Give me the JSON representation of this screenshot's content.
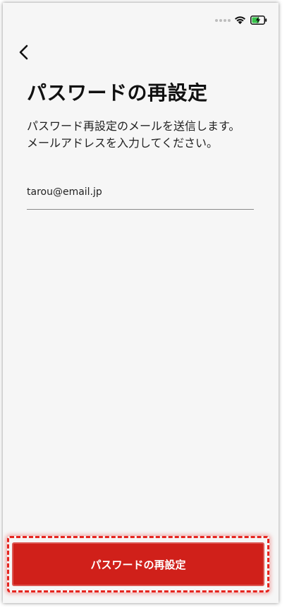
{
  "status_bar": {
    "signal_icon": "signal-dots-icon",
    "wifi_icon": "wifi-icon",
    "battery_icon": "battery-charging-icon",
    "battery_color": "#37c44a"
  },
  "nav": {
    "back_icon": "chevron-left-icon"
  },
  "page": {
    "title": "パスワードの再設定",
    "description_line1": "パスワード再設定のメールを送信します。",
    "description_line2": "メールアドレスを入力してください。"
  },
  "form": {
    "email_value": "tarou@email.jp"
  },
  "actions": {
    "submit_label": "パスワードの再設定"
  },
  "colors": {
    "accent": "#d0201a",
    "background": "#f6f6f6"
  }
}
